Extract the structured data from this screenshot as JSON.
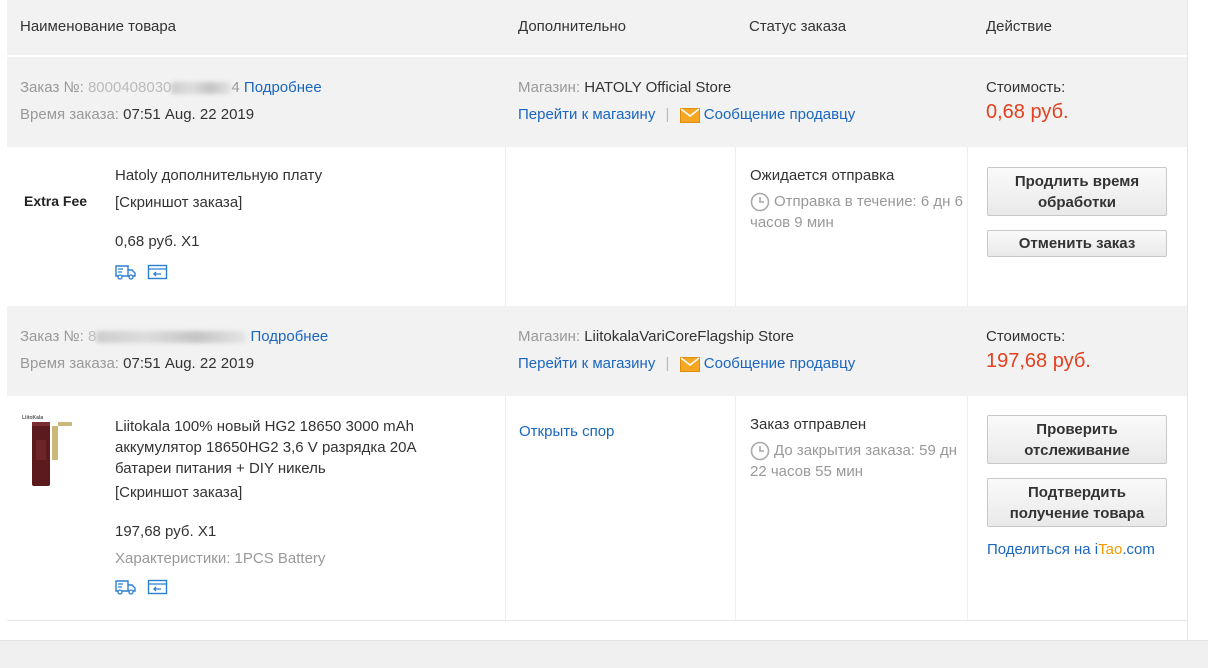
{
  "header": {
    "col_product": "Наименование товара",
    "col_extra": "Дополнительно",
    "col_status": "Статус заказа",
    "col_action": "Действие"
  },
  "orders": [
    {
      "order_label": "Заказ №:",
      "order_number_visible": "8000408030",
      "order_number_tail": "4",
      "details_link": "Подробнее",
      "time_label": "Время заказа:",
      "time_value": "07:51 Aug. 22 2019",
      "store_label": "Магазин:",
      "store_name": "HATOLY Official Store",
      "go_store": "Перейти к магазину",
      "separator": "|",
      "message_seller": "Сообщение продавцу",
      "cost_label": "Стоимость:",
      "cost_value": "0,68 руб.",
      "item": {
        "thumb_text": "Extra Fee",
        "title": "Hatoly дополнительную плату",
        "snapshot": "[Скриншот заказа]",
        "price_qty": "0,68 руб. X1",
        "extra_link": "",
        "status": "Ожидается отправка",
        "status_detail": "Отправка в течение: 6 дн 6 часов 9 мин",
        "btn1": "Продлить время обработки",
        "btn2": "Отменить заказ"
      }
    },
    {
      "order_label": "Заказ №:",
      "order_number_visible": "8",
      "details_link": "Подробнее",
      "time_label": "Время заказа:",
      "time_value": "07:51 Aug. 22 2019",
      "store_label": "Магазин:",
      "store_name": "LiitokalaVariCoreFlagship Store",
      "go_store": "Перейти к магазину",
      "separator": "|",
      "message_seller": "Сообщение продавцу",
      "cost_label": "Стоимость:",
      "cost_value": "197,68 руб.",
      "item": {
        "title": "Liitokala 100% новый HG2 18650 3000 mAh аккумулятор 18650HG2 3,6 V разрядка 20A батареи питания + DIY никель",
        "snapshot": "[Скриншот заказа]",
        "price_qty": "197,68 руб. X1",
        "specs": "Характеристики: 1PCS Battery",
        "extra_link": "Открыть спор",
        "status": "Заказ отправлен",
        "status_detail": "До закрытия заказа: 59 дн 22 часов 55 мин",
        "btn1": "Проверить отслеживание",
        "btn2": "Подтвердить получение товара",
        "share_prefix": "Поделиться на ",
        "share_i": "i",
        "share_tao": "Tao",
        "share_com": ".com"
      }
    }
  ],
  "colors": {
    "link": "#1a66c0",
    "price": "#e43f1e",
    "header_bg": "#f2f2f2",
    "itao_orange": "#f59a00"
  }
}
